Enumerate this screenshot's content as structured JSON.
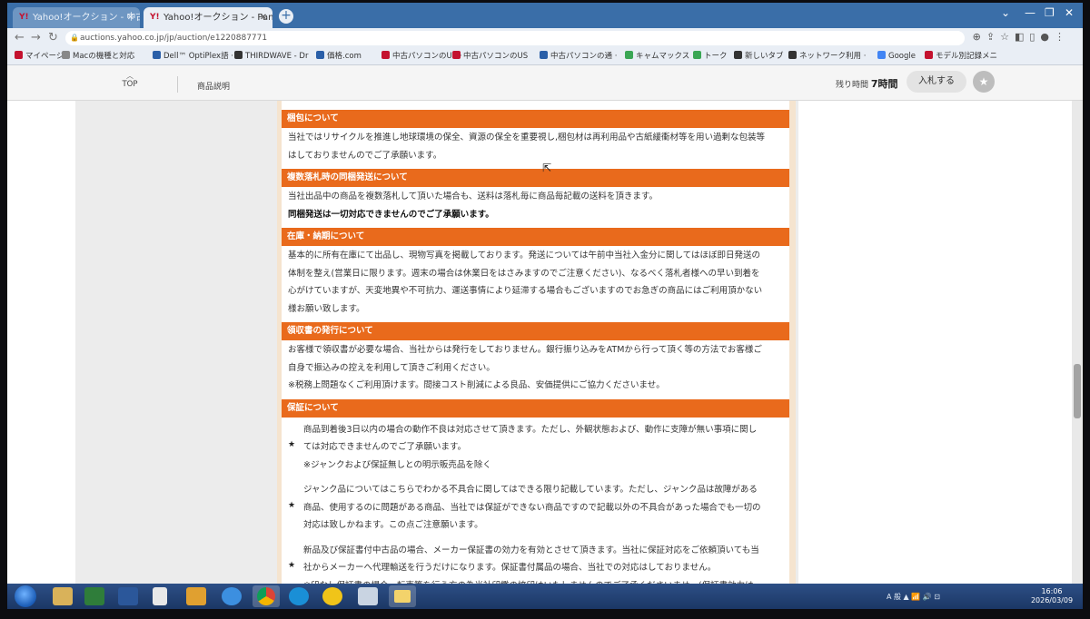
{
  "browser": {
    "tabs": [
      {
        "title": "Yahoo!オークション - 中古パ",
        "active": false
      },
      {
        "title": "Yahoo!オークション - Panaso",
        "active": true
      }
    ],
    "url": "auctions.yahoo.co.jp/jp/auction/e1220887771",
    "bookmarks": [
      {
        "label": "マイページ",
        "icon_color": "#c4122f"
      },
      {
        "label": "Macの機種と対応",
        "icon_color": "#888888"
      },
      {
        "label": "Dell™ OptiPlex語 ·",
        "icon_color": "#2a5fa8"
      },
      {
        "label": "THIRDWAVE - Dr",
        "icon_color": "#333333"
      },
      {
        "label": "価格.com",
        "icon_color": "#2a5fa8"
      },
      {
        "label": "中古パソコンのUS ·",
        "icon_color": "#c4122f"
      },
      {
        "label": "中古パソコンのUS",
        "icon_color": "#c4122f"
      },
      {
        "label": "中古パソコンの通 ·",
        "icon_color": "#2a5fa8"
      },
      {
        "label": "キャムマックス",
        "icon_color": "#3aa655"
      },
      {
        "label": "トーク",
        "icon_color": "#3aa655"
      },
      {
        "label": "新しいタブ",
        "icon_color": "#333333"
      },
      {
        "label": "ネットワーク利用 ·",
        "icon_color": "#333333"
      },
      {
        "label": "Google",
        "icon_color": "#4285f4"
      },
      {
        "label": "モデル別記録メニ",
        "icon_color": "#c4122f"
      }
    ]
  },
  "page_header": {
    "top_label": "TOP",
    "description_label": "商品説明",
    "time_left_label": "残り時間",
    "time_left_value": "7時間",
    "bid_button": "入札する"
  },
  "sections": [
    {
      "title": "梱包について",
      "lines": [
        {
          "text": "当社ではリサイクルを推進し地球環境の保全、資源の保全を重要視し,梱包材は再利用品や古紙緩衝材等を用い過剰な包装等",
          "bold": false
        },
        {
          "text": "はしておりませんのでご了承願います。",
          "bold": false
        }
      ]
    },
    {
      "title": "複数落札時の同梱発送について",
      "lines": [
        {
          "text": "当社出品中の商品を複数落札して頂いた場合も、送料は落札毎に商品毎記載の送料を頂きます。",
          "bold": false
        },
        {
          "text": "同梱発送は一切対応できませんのでご了承願います。",
          "bold": true
        }
      ]
    },
    {
      "title": "在庫・納期について",
      "lines": [
        {
          "text": "基本的に所有在庫にて出品し、現物写真を掲載しております。発送については午前中当社入金分に関してはほぼ即日発送の",
          "bold": false
        },
        {
          "text": "体制を整え(営業日に限ります。週末の場合は休業日をはさみますのでご注意ください)、なるべく落札者様への早い到着を",
          "bold": false
        },
        {
          "text": "心がけていますが、天変地異や不可抗力、運送事情により延滞する場合もございますのでお急ぎの商品にはご利用頂かない",
          "bold": false
        },
        {
          "text": "様お願い致します。",
          "bold": false
        }
      ]
    },
    {
      "title": "領収書の発行について",
      "lines": [
        {
          "text": "お客様で領収書が必要な場合、当社からは発行をしておりません。銀行振り込みをATMから行って頂く等の方法でお客様ご",
          "bold": false
        },
        {
          "text": "自身で振込みの控えを利用して頂きご利用ください。",
          "bold": false
        },
        {
          "text": "※税務上問題なくご利用頂けます。間接コスト削減による良品、安価提供にご協力くださいませ。",
          "bold": false
        }
      ]
    },
    {
      "title": "保証について",
      "items": [
        {
          "lines": [
            "商品到着後3日以内の場合の動作不良は対応させて頂きます。ただし、外観状態および、動作に支障が無い事項に関し",
            "ては対応できませんのでご了承願います。",
            "※ジャンクおよび保証無しとの明示販売品を除く"
          ]
        },
        {
          "lines": [
            "ジャンク品についてはこちらでわかる不具合に関してはできる限り記載しています。ただし、ジャンク品は故障がある",
            "商品、使用するのに問題がある商品、当社では保証ができない商品ですので記載以外の不具合があった場合でも一切の",
            "対応は致しかねます。この点ご注意願います。"
          ]
        },
        {
          "lines": [
            "新品及び保証書付中古品の場合、メーカー保証書の効力を有効とさせて頂きます。当社に保証対応をご依頼頂いても当",
            "社からメーカーへ代理輸送を行うだけになります。保証書付属品の場合、当社での対応はしておりません。",
            "※印なし保証書の場合、転売等を行う方の為当社印鑑の捺印はいたしませんのでご了承くださいませ。(保証書効力は"
          ]
        }
      ]
    }
  ],
  "taskbar": {
    "tray_text": "A 般 ▲ 📶 🔊 ⊡",
    "time": "16:06",
    "date": "2026/03/09"
  }
}
